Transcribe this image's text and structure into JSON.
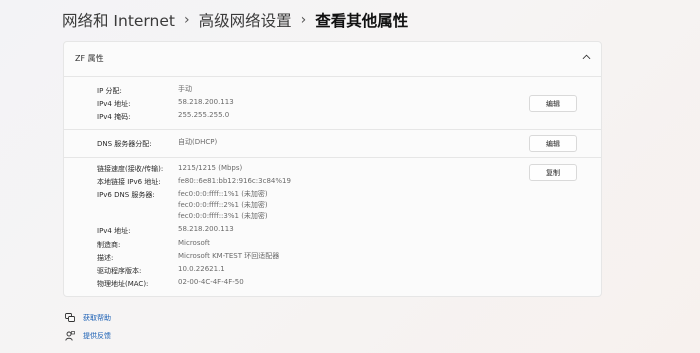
{
  "breadcrumb": {
    "items": [
      "网络和 Internet",
      "高级网络设置"
    ],
    "current": "查看其他属性",
    "separator": "›"
  },
  "card": {
    "title": "ZF 属性",
    "section1": {
      "rows": [
        {
          "label": "IP 分配:",
          "value": "手动"
        },
        {
          "label": "IPv4 地址:",
          "value": "58.218.200.113"
        },
        {
          "label": "IPv4 掩码:",
          "value": "255.255.255.0"
        }
      ],
      "edit_label": "编辑"
    },
    "section2": {
      "rows": [
        {
          "label": "DNS 服务器分配:",
          "value": "自动(DHCP)"
        }
      ],
      "edit_label": "编辑"
    },
    "section3": {
      "copy_label": "复制",
      "rows": [
        {
          "label": "链接速度(接收/传输):",
          "value": "1215/1215 (Mbps)"
        },
        {
          "label": "本地链接 IPv6 地址:",
          "value": "fe80::6e81:bb12:916c:3c84%19"
        },
        {
          "label": "IPv6 DNS 服务器:",
          "values": [
            "fec0:0:0:ffff::1%1 (未加密)",
            "fec0:0:0:ffff::2%1 (未加密)",
            "fec0:0:0:ffff::3%1 (未加密)"
          ]
        },
        {
          "label": "IPv4 地址:",
          "value": "58.218.200.113"
        },
        {
          "label": "制造商:",
          "value": "Microsoft"
        },
        {
          "label": "描述:",
          "value": "Microsoft KM-TEST 环回适配器"
        },
        {
          "label": "驱动程序版本:",
          "value": "10.0.22621.1"
        },
        {
          "label": "物理地址(MAC):",
          "value": "02-00-4C-4F-4F-50"
        }
      ]
    }
  },
  "footer": {
    "help": "获取帮助",
    "feedback": "提供反馈"
  },
  "colors": {
    "accent": "#1a5fb4",
    "card_bg": "#fbfbfb",
    "border": "#e6e6e6"
  },
  "icons": {
    "breadcrumb_separator": "chevron-right-icon",
    "collapse": "chevron-up-icon",
    "help": "help-chat-icon",
    "feedback": "feedback-person-icon"
  }
}
